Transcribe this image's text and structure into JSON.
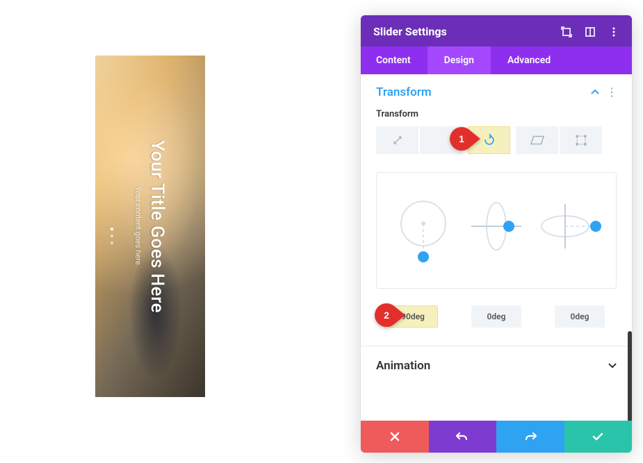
{
  "preview": {
    "title": "Your Title Goes Here",
    "subtitle": "Your content goes here."
  },
  "panel": {
    "title": "Slider Settings",
    "tabs": {
      "content": "Content",
      "design": "Design",
      "advanced": "Advanced",
      "active": "Design"
    },
    "sections": {
      "transform": {
        "title": "Transform",
        "label": "Transform",
        "selected_tool": "rotate",
        "values": {
          "z": "90deg",
          "x": "0deg",
          "y": "0deg"
        }
      },
      "animation": {
        "title": "Animation"
      }
    }
  },
  "annotations": {
    "marker1": "1",
    "marker2": "2"
  }
}
